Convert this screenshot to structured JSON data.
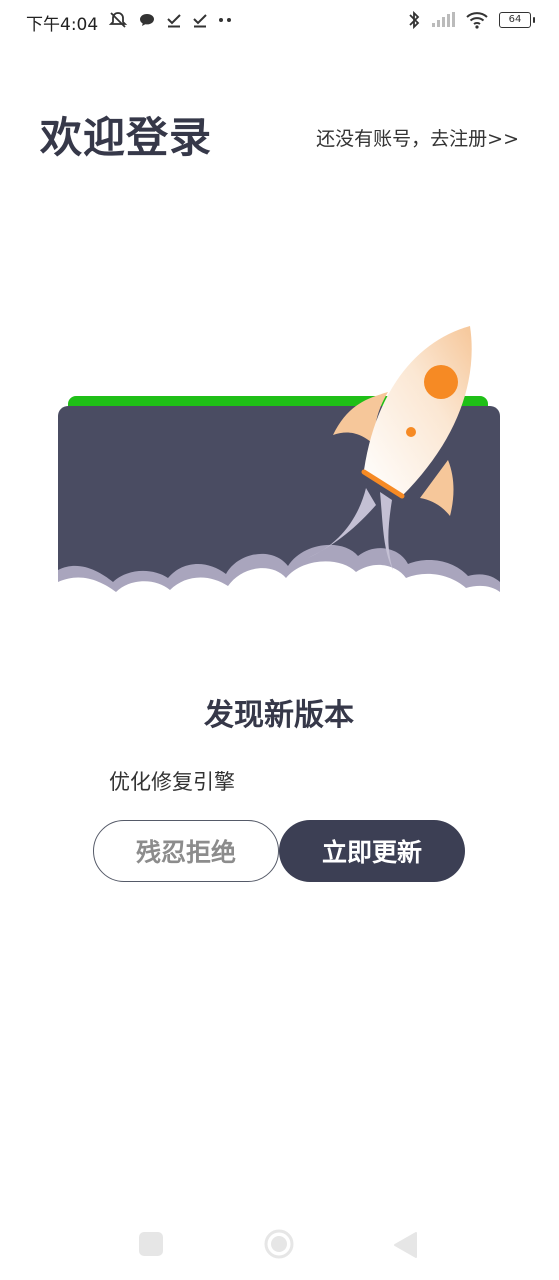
{
  "status_bar": {
    "time": "下午4:04",
    "battery": "64",
    "left_icons": [
      "mute-bell-icon",
      "chat-bubble-icon",
      "check-icon",
      "check-icon",
      "more-dots-icon"
    ],
    "right_icons": [
      "bluetooth-icon",
      "signal-icon",
      "wifi-icon",
      "battery-icon"
    ]
  },
  "header": {
    "title": "欢迎登录",
    "register_link": "还没有账号，去注册>>"
  },
  "update_dialog": {
    "title": "发现新版本",
    "description": "优化修复引擎",
    "cancel_label": "残忍拒绝",
    "confirm_label": "立即更新",
    "banner_icon": "rocket-icon"
  },
  "nav_bar": {
    "icons": [
      "recent-apps-icon",
      "home-icon",
      "back-icon"
    ]
  },
  "colors": {
    "primary_dark": "#3c3f54",
    "banner_dark": "#4a4c62",
    "banner_green": "#1fbf17",
    "rocket_orange": "#f68a24"
  }
}
